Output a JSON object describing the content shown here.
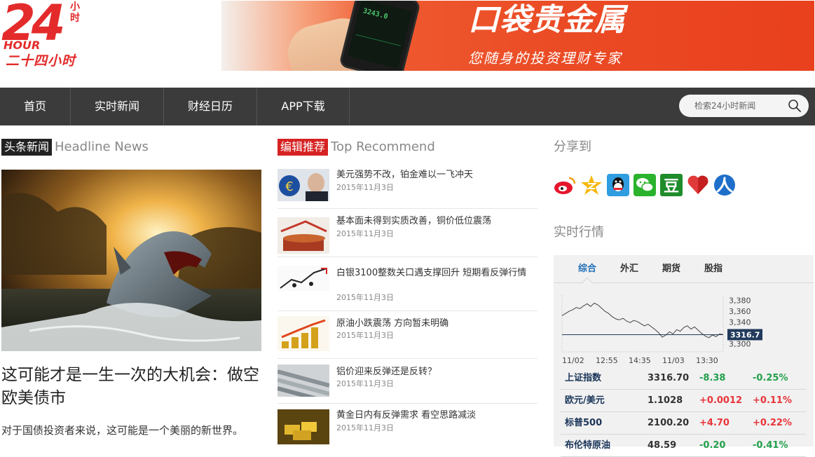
{
  "logo": {
    "number": "24",
    "small": "小时",
    "hour": "HOUR",
    "cn": "二十四小时"
  },
  "banner": {
    "title": "口袋贵金属",
    "subtitle": "您随身的投资理财专家",
    "phone_price": "3243.0"
  },
  "nav": {
    "items": [
      "首页",
      "实时新闻",
      "财经日历",
      "APP下载"
    ],
    "search_placeholder": "检索24小时新闻"
  },
  "headline": {
    "badge": "头条新闻",
    "en": "Headline News",
    "title": "这可能才是一生一次的大机会：做空欧美债市",
    "summary": "对于国债投资者来说，这可能是一个美丽的新世界。"
  },
  "recommend": {
    "badge": "编辑推荐",
    "en": "Top Recommend",
    "items": [
      {
        "title": "美元强势不改，铂金难以一飞冲天",
        "date": "2015年11月3日",
        "thumb": "euro-portrait"
      },
      {
        "title": "基本面未得到实质改善，铜价低位震荡",
        "date": "2015年11月3日",
        "thumb": "copper"
      },
      {
        "title": "白银3100整数关口遇支撑回升 短期看反弹行情",
        "date": "2015年11月3日",
        "thumb": "cartoon"
      },
      {
        "title": "原油小跌震荡 方向暂未明确",
        "date": "2015年11月3日",
        "thumb": "gold-bars-chart"
      },
      {
        "title": "铝价迎来反弹还是反转？",
        "date": "2015年11月3日",
        "thumb": "aluminum"
      },
      {
        "title": "黄金日内有反弹需求 看空思路减淡",
        "date": "2015年11月3日",
        "thumb": "gold"
      }
    ]
  },
  "share": {
    "label": "分享到",
    "icons": [
      "weibo-icon",
      "qzone-icon",
      "qq-icon",
      "wechat-icon",
      "douban-icon",
      "heart-icon",
      "renren-icon"
    ]
  },
  "market": {
    "label": "实时行情",
    "tabs": [
      "综合",
      "外汇",
      "期货",
      "股指"
    ],
    "active_tab": 0,
    "rows": [
      {
        "name": "上证指数",
        "value": "3316.70",
        "change": "-8.38",
        "pct": "-0.25%",
        "dir": "down"
      },
      {
        "name": "欧元/美元",
        "value": "1.1028",
        "change": "+0.0012",
        "pct": "+0.11%",
        "dir": "up"
      },
      {
        "name": "标普500",
        "value": "2100.20",
        "change": "+4.70",
        "pct": "+0.22%",
        "dir": "up"
      },
      {
        "name": "布伦特原油",
        "value": "48.59",
        "change": "-0.20",
        "pct": "-0.41%",
        "dir": "down"
      }
    ],
    "colors": {
      "up": "#e8343a",
      "down": "#22a04b",
      "tab_active": "#1f6fb6"
    }
  },
  "chart_data": {
    "type": "line",
    "x_ticks": [
      "11/02",
      "12:55",
      "14:35",
      "11/03",
      "13:30"
    ],
    "y_ticks": [
      "3,380",
      "3,360",
      "3,340",
      "3,300"
    ],
    "ylim": [
      3290,
      3390
    ],
    "current": "3316.7",
    "current_value": 3316.7,
    "values": [
      3352,
      3356,
      3360,
      3363,
      3367,
      3365,
      3370,
      3374,
      3369,
      3375,
      3372,
      3366,
      3360,
      3356,
      3350,
      3346,
      3344,
      3347,
      3342,
      3339,
      3343,
      3341,
      3337,
      3333,
      3336,
      3331,
      3326,
      3320,
      3312,
      3316,
      3322,
      3318,
      3326,
      3323,
      3330,
      3333,
      3327,
      3331,
      3325,
      3319,
      3314,
      3311,
      3316,
      3313,
      3318,
      3316.7
    ]
  }
}
